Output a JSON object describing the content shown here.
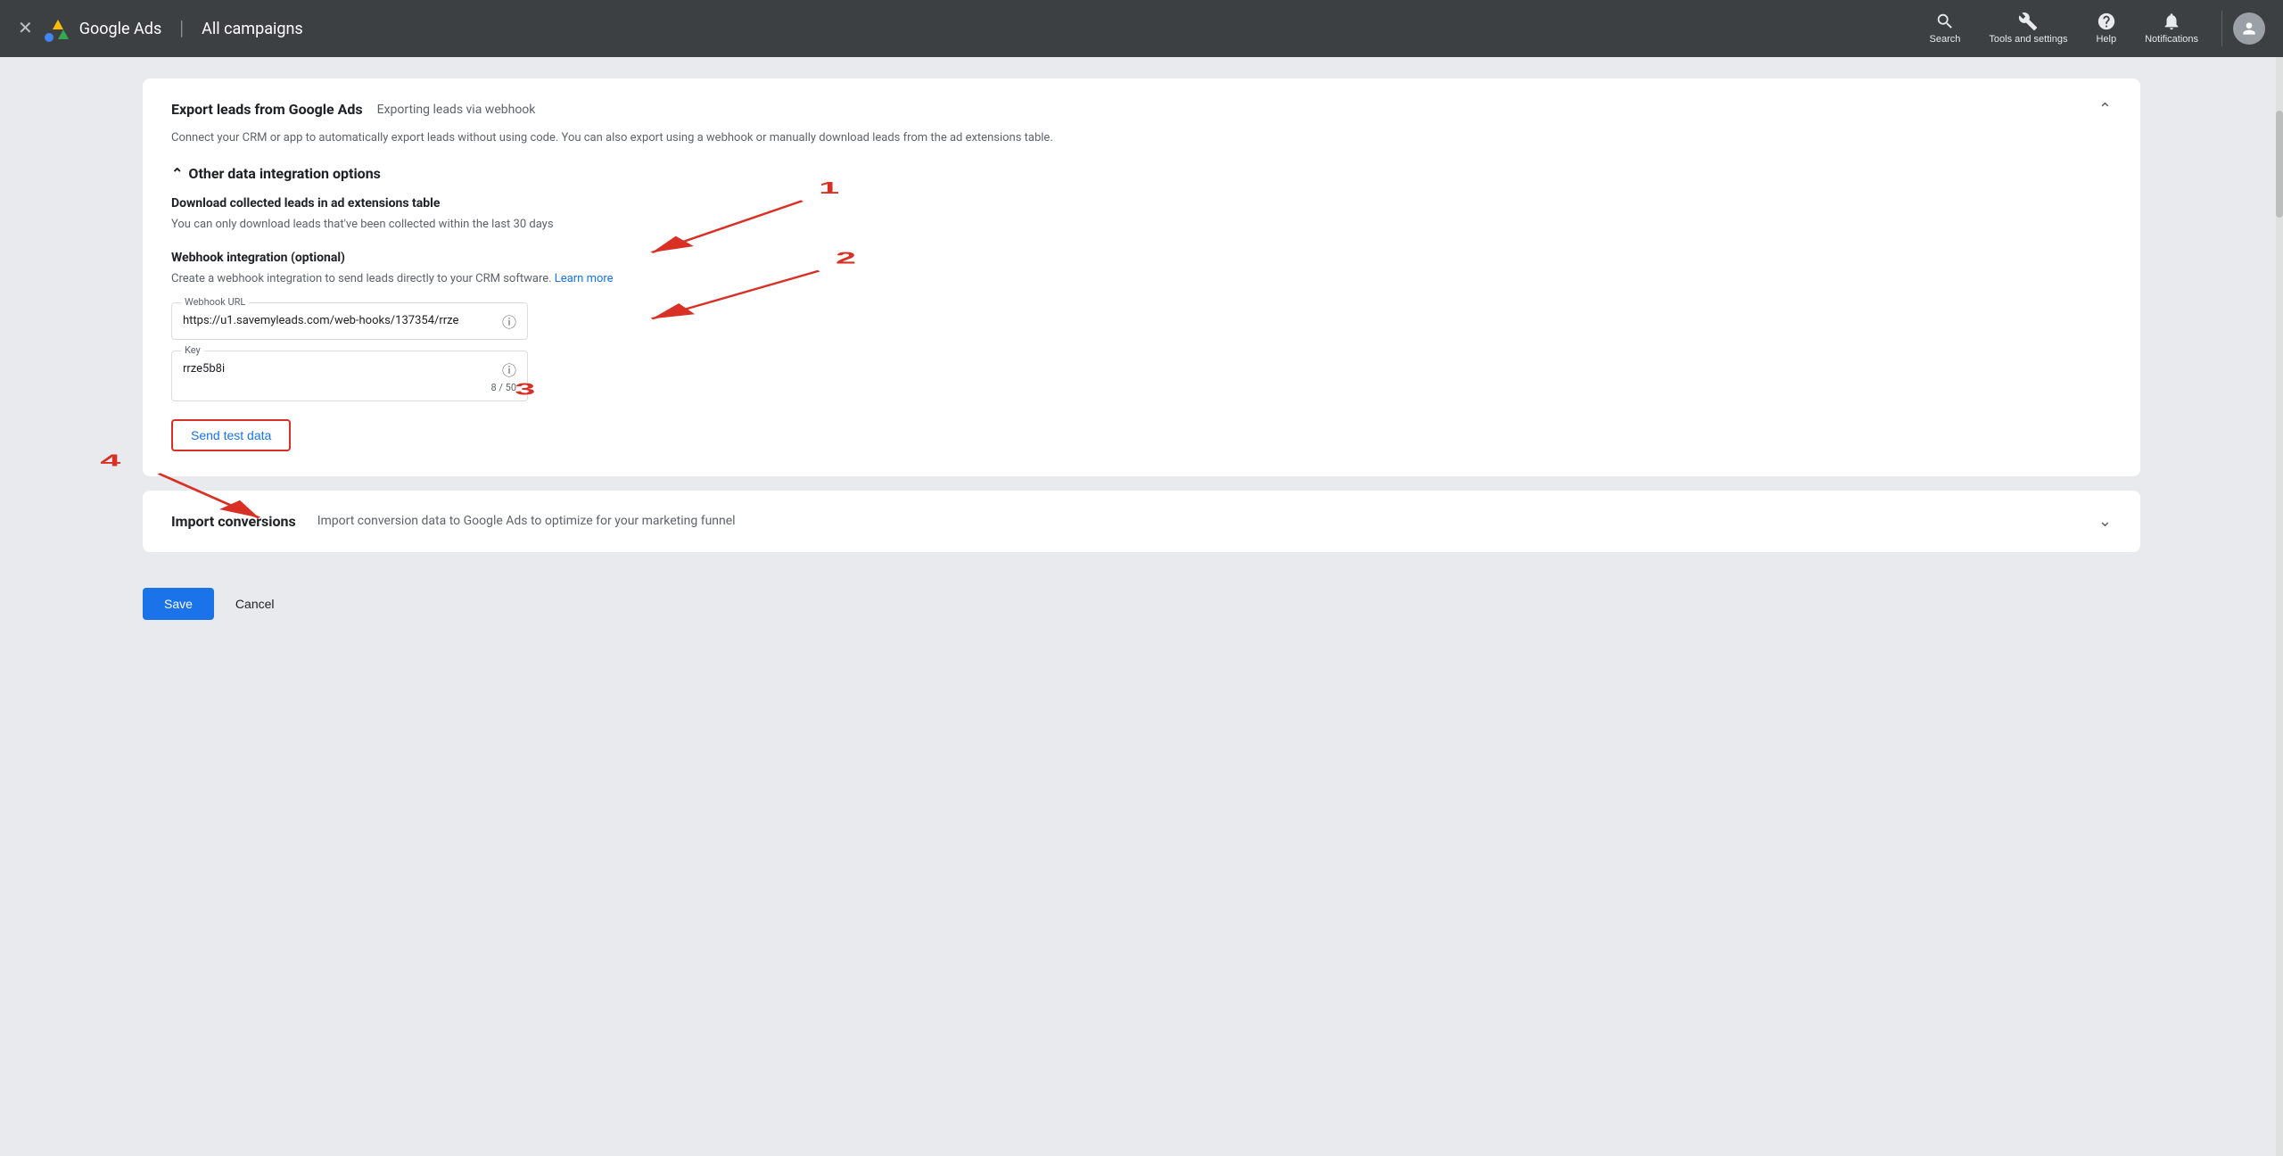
{
  "topnav": {
    "close_label": "✕",
    "logo_text": "Google Ads",
    "divider": "|",
    "page_title": "All campaigns",
    "search_label": "Search",
    "tools_label": "Tools and settings",
    "help_label": "Help",
    "notifications_label": "Notifications"
  },
  "export_card": {
    "title": "Export leads from Google Ads",
    "subtitle": "Exporting leads via webhook",
    "description": "Connect your CRM or app to automatically export leads without using code. You can also export using a webhook or manually download leads from the ad extensions table.",
    "other_integration_label": "Other data integration options",
    "download_title": "Download collected leads in ad extensions table",
    "download_desc": "You can only download leads that've been collected within the last 30 days",
    "webhook_title": "Webhook integration (optional)",
    "webhook_desc": "Create a webhook integration to send leads directly to your CRM software.",
    "learn_more_label": "Learn more",
    "webhook_url_label": "Webhook URL",
    "webhook_url_value": "https://u1.savemyleads.com/web-hooks/137354/rrze",
    "key_label": "Key",
    "key_value": "rrze5b8i",
    "key_counter": "8 / 50",
    "send_test_label": "Send test data"
  },
  "import_card": {
    "title": "Import conversions",
    "description": "Import conversion data to Google Ads to optimize for your marketing funnel"
  },
  "bottom_bar": {
    "save_label": "Save",
    "cancel_label": "Cancel"
  },
  "annotations": {
    "label_1": "1",
    "label_2": "2",
    "label_3": "3",
    "label_4": "4"
  }
}
